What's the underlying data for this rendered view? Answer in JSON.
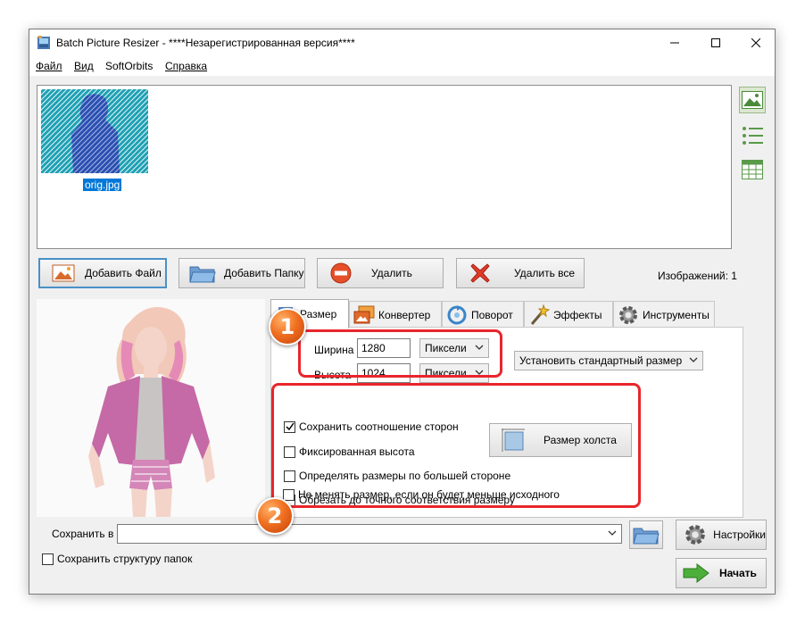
{
  "window": {
    "title": "Batch Picture Resizer - ****Незарегистрированная версия****"
  },
  "menu": [
    {
      "label": "Файл"
    },
    {
      "label": "Вид"
    },
    {
      "label": "SoftOrbits"
    },
    {
      "label": "Справка"
    }
  ],
  "gallery": {
    "items": [
      {
        "filename": "orig.jpg"
      }
    ]
  },
  "toolbar": {
    "add_file": "Добавить Файл",
    "add_folder": "Добавить Папку",
    "delete": "Удалить",
    "delete_all": "Удалить все",
    "image_count": "Изображений: 1"
  },
  "tabs": [
    {
      "label": "Размер",
      "active": true
    },
    {
      "label": "Конвертер"
    },
    {
      "label": "Поворот"
    },
    {
      "label": "Эффекты"
    },
    {
      "label": "Инструменты"
    }
  ],
  "size": {
    "width_label": "Ширина",
    "width_value": "1280",
    "width_unit": "Пиксели",
    "height_label": "Высота",
    "height_value": "1024",
    "height_unit": "Пиксели",
    "preset": "Установить стандартный размер"
  },
  "options": [
    {
      "label": "Сохранить соотношение сторон",
      "checked": true
    },
    {
      "label": "Фиксированная высота",
      "checked": false
    },
    {
      "label": "Определять размеры по большей стороне",
      "checked": false
    },
    {
      "label": "Обрезать до точного соответствия размеру",
      "checked": false
    },
    {
      "label": "Не менять размер, если он будет меньше исходного",
      "checked": false
    }
  ],
  "canvas_size_button": "Размер холста",
  "annotations": [
    {
      "label": "1"
    },
    {
      "label": "2"
    }
  ],
  "save": {
    "label": "Сохранить в",
    "path": "",
    "keep_structure": "Сохранить структуру папок",
    "keep_structure_checked": false
  },
  "settings_button": "Настройки",
  "start_button": "Начать",
  "colors": {
    "accent": "#0078d7",
    "annotation_red": "#e8262c",
    "badge_orange": "#f07020"
  }
}
